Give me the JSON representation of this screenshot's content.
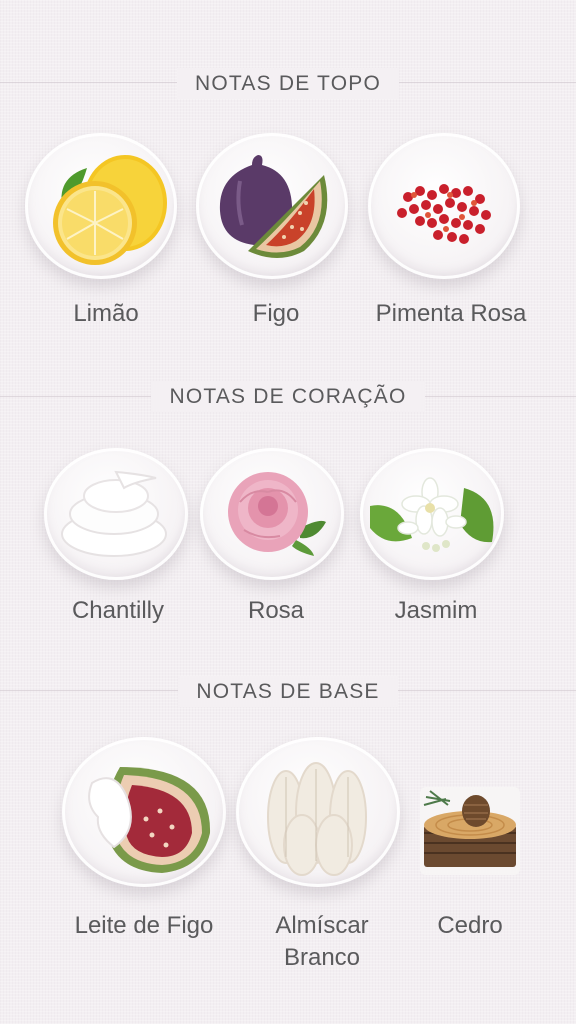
{
  "sections": [
    {
      "title": "NOTAS DE TOPO",
      "notes": [
        {
          "label": "Limão",
          "icon": "lemon-icon"
        },
        {
          "label": "Figo",
          "icon": "fig-icon"
        },
        {
          "label": "Pimenta Rosa",
          "icon": "pink-pepper-icon"
        }
      ]
    },
    {
      "title": "NOTAS DE CORAÇÃO",
      "notes": [
        {
          "label": "Chantilly",
          "icon": "whipped-cream-icon"
        },
        {
          "label": "Rosa",
          "icon": "rose-icon"
        },
        {
          "label": "Jasmim",
          "icon": "jasmine-icon"
        }
      ]
    },
    {
      "title": "NOTAS DE BASE",
      "notes": [
        {
          "label": "Leite de Figo",
          "icon": "fig-milk-icon"
        },
        {
          "label": "Almíscar Branco",
          "icon": "white-musk-icon"
        },
        {
          "label": "Cedro",
          "icon": "cedar-icon"
        }
      ]
    }
  ],
  "colors": {
    "background": "#f3eff2",
    "text": "#5a5a5c"
  }
}
